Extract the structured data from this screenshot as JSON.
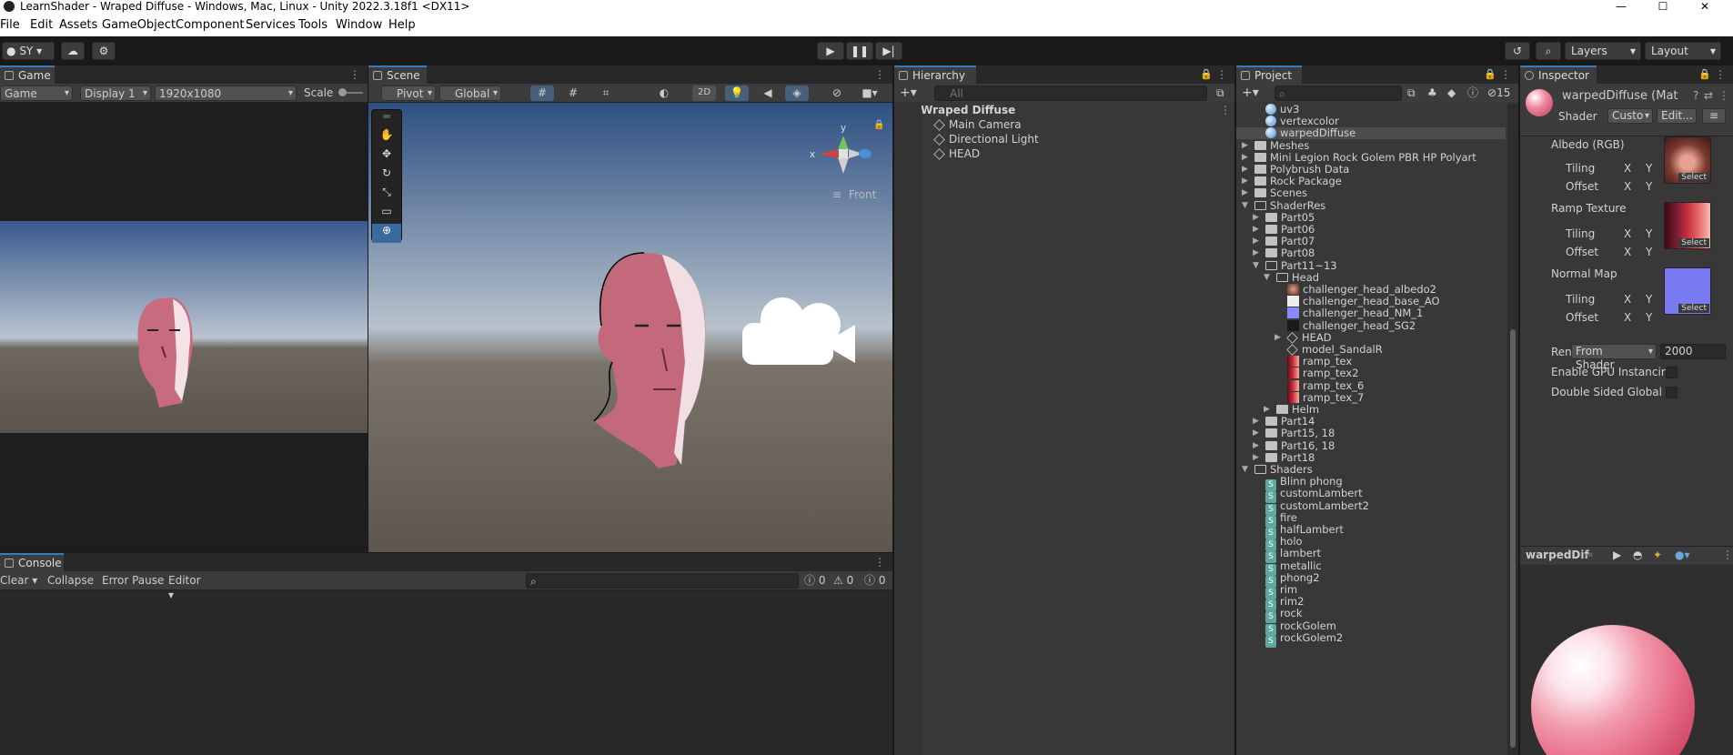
{
  "window": {
    "title": "LearnShader - Wraped Diffuse - Windows, Mac, Linux - Unity 2022.3.18f1 <DX11>",
    "controls": [
      "minimize-icon",
      "maximize-icon",
      "close-icon"
    ]
  },
  "menu": [
    "File",
    "Edit",
    "Assets",
    "GameObject",
    "Component",
    "Services",
    "Tools",
    "Window",
    "Help"
  ],
  "toolbar": {
    "account": "SY",
    "play_icon": "play-icon",
    "pause_icon": "pause-icon",
    "step_icon": "step-icon",
    "layers": "Layers",
    "layout": "Layout"
  },
  "game": {
    "tab": "Game",
    "mode": "Game",
    "display": "Display 1",
    "resolution": "1920x1080",
    "scale": "Scale"
  },
  "scene": {
    "tab": "Scene",
    "pivot": "Pivot",
    "global": "Global",
    "mode_2d": "2D",
    "gizmo_x": "x",
    "gizmo_y": "y",
    "gizmo_view": "Front"
  },
  "hierarchy": {
    "tab": "Hierarchy",
    "search_placeholder": "All",
    "root": "Wraped Diffuse",
    "children": [
      "Main Camera",
      "Directional Light",
      "HEAD"
    ]
  },
  "project": {
    "tab": "Project",
    "hidden_count": "15",
    "items": [
      {
        "label": "uv3",
        "indent": 2,
        "icon": "material"
      },
      {
        "label": "vertexcolor",
        "indent": 2,
        "icon": "material"
      },
      {
        "label": "warpedDiffuse",
        "indent": 2,
        "icon": "material",
        "selected": true
      },
      {
        "label": "Meshes",
        "indent": 1,
        "icon": "folder",
        "arrow": "right"
      },
      {
        "label": "Mini Legion Rock Golem PBR HP Polyart",
        "indent": 1,
        "icon": "folder",
        "arrow": "right"
      },
      {
        "label": "Polybrush Data",
        "indent": 1,
        "icon": "folder",
        "arrow": "right"
      },
      {
        "label": "Rock Package",
        "indent": 1,
        "icon": "folder",
        "arrow": "right"
      },
      {
        "label": "Scenes",
        "indent": 1,
        "icon": "folder",
        "arrow": "right"
      },
      {
        "label": "ShaderRes",
        "indent": 1,
        "icon": "folder-open",
        "arrow": "down"
      },
      {
        "label": "Part05",
        "indent": 2,
        "icon": "folder",
        "arrow": "right"
      },
      {
        "label": "Part06",
        "indent": 2,
        "icon": "folder",
        "arrow": "right"
      },
      {
        "label": "Part07",
        "indent": 2,
        "icon": "folder",
        "arrow": "right"
      },
      {
        "label": "Part08",
        "indent": 2,
        "icon": "folder",
        "arrow": "right"
      },
      {
        "label": "Part11~13",
        "indent": 2,
        "icon": "folder-open",
        "arrow": "down"
      },
      {
        "label": "Head",
        "indent": 3,
        "icon": "folder-open",
        "arrow": "down"
      },
      {
        "label": "challenger_head_albedo2",
        "indent": 4,
        "icon": "texture-face"
      },
      {
        "label": "challenger_head_base_AO",
        "indent": 4,
        "icon": "texture-white"
      },
      {
        "label": "challenger_head_NM_1",
        "indent": 4,
        "icon": "texture-normal"
      },
      {
        "label": "challenger_head_SG2",
        "indent": 4,
        "icon": "texture-dark"
      },
      {
        "label": "HEAD",
        "indent": 4,
        "icon": "prefab",
        "arrow": "right"
      },
      {
        "label": "model_SandalR",
        "indent": 4,
        "icon": "prefab"
      },
      {
        "label": "ramp_tex",
        "indent": 4,
        "icon": "texture-ramp"
      },
      {
        "label": "ramp_tex2",
        "indent": 4,
        "icon": "texture-ramp"
      },
      {
        "label": "ramp_tex_6",
        "indent": 4,
        "icon": "texture-ramp"
      },
      {
        "label": "ramp_tex_7",
        "indent": 4,
        "icon": "texture-ramp"
      },
      {
        "label": "Helm",
        "indent": 3,
        "icon": "folder",
        "arrow": "right"
      },
      {
        "label": "Part14",
        "indent": 2,
        "icon": "folder",
        "arrow": "right"
      },
      {
        "label": "Part15, 18",
        "indent": 2,
        "icon": "folder",
        "arrow": "right"
      },
      {
        "label": "Part16, 18",
        "indent": 2,
        "icon": "folder",
        "arrow": "right"
      },
      {
        "label": "Part18",
        "indent": 2,
        "icon": "folder",
        "arrow": "right"
      },
      {
        "label": "Shaders",
        "indent": 1,
        "icon": "folder-open",
        "arrow": "down"
      },
      {
        "label": "Blinn phong",
        "indent": 2,
        "icon": "shader"
      },
      {
        "label": "customLambert",
        "indent": 2,
        "icon": "shader"
      },
      {
        "label": "customLambert2",
        "indent": 2,
        "icon": "shader"
      },
      {
        "label": "fire",
        "indent": 2,
        "icon": "shader"
      },
      {
        "label": "halfLambert",
        "indent": 2,
        "icon": "shader"
      },
      {
        "label": "holo",
        "indent": 2,
        "icon": "shader"
      },
      {
        "label": "lambert",
        "indent": 2,
        "icon": "shader"
      },
      {
        "label": "metallic",
        "indent": 2,
        "icon": "shader"
      },
      {
        "label": "phong2",
        "indent": 2,
        "icon": "shader"
      },
      {
        "label": "rim",
        "indent": 2,
        "icon": "shader"
      },
      {
        "label": "rim2",
        "indent": 2,
        "icon": "shader"
      },
      {
        "label": "rock",
        "indent": 2,
        "icon": "shader"
      },
      {
        "label": "rockGolem",
        "indent": 2,
        "icon": "shader"
      },
      {
        "label": "rockGolem2",
        "indent": 2,
        "icon": "shader"
      }
    ]
  },
  "inspector": {
    "tab": "Inspector",
    "material_name": "warpedDiffuse (Mat",
    "shader_label": "Shader",
    "shader_value": "Custo",
    "edit_button": "Edit...",
    "albedo": "Albedo (RGB)",
    "ramp": "Ramp Texture",
    "normal": "Normal Map",
    "tiling": "Tiling",
    "offset": "Offset",
    "x": "X",
    "y": "Y",
    "select": "Select",
    "render_queue_label": "Ren",
    "render_queue_source": "From Shader",
    "render_queue_value": "2000",
    "gpu_instancing": "Enable GPU Instancin",
    "double_sided": "Double Sided Global I",
    "preview_name": "warpedDif"
  },
  "console": {
    "tab": "Console",
    "clear": "Clear",
    "collapse": "Collapse",
    "error_pause": "Error Pause",
    "editor": "Editor",
    "log_count": "0",
    "warn_count": "0",
    "error_count": "0"
  },
  "colors": {
    "accent": "#3a79bb",
    "selection": "#2c5d87",
    "panel": "#383838",
    "skin": "#e8708a"
  }
}
